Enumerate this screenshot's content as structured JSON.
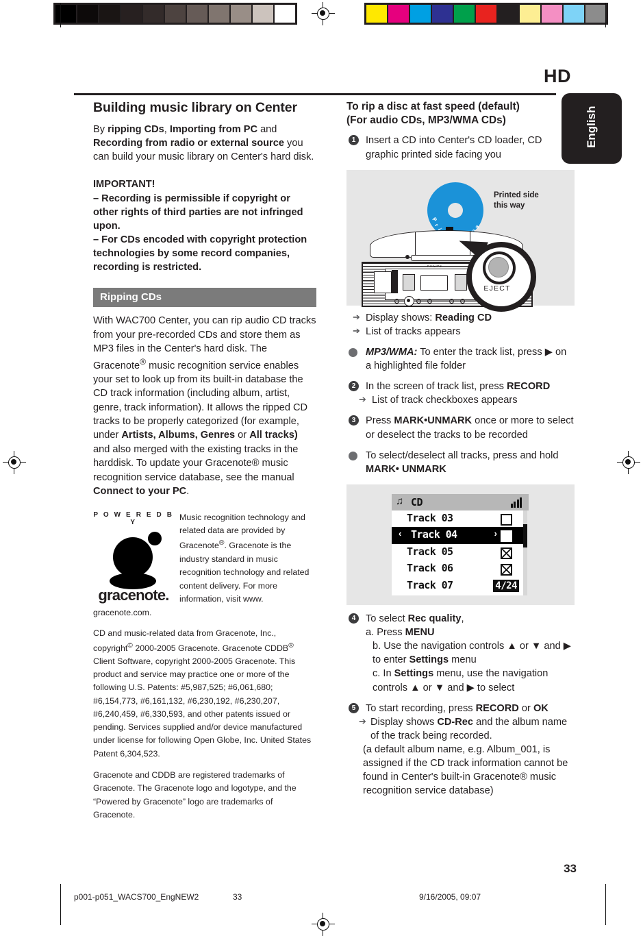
{
  "header": {
    "chapter": "HD",
    "language_tab": "English",
    "page_number": "33"
  },
  "left_column": {
    "title": "Building music library on Center",
    "intro": {
      "t1": "By ",
      "b1": "ripping CDs",
      "t2": ", ",
      "b2": "Importing from PC",
      "t3": " and ",
      "b3": "Recording from radio or external source",
      "t4": " you can build your music library on Center's hard disk."
    },
    "important": {
      "heading": "IMPORTANT!",
      "item1": "–   Recording is permissible if copyright or other rights of third parties are not infringed upon.",
      "item2": "–   For CDs encoded with copyright protection technologies by some record companies,  recording is restricted."
    },
    "band_heading": "Ripping CDs",
    "rip_body": {
      "p1": "With WAC700 Center, you can rip audio CD tracks from your pre-recorded CDs and store them as MP3 files in the Center's hard disk. The Gracenote",
      "sup1": "®",
      "p2": " music recognition service enables your set to look up from its built-in database the CD track information (including album, artist, genre, track information). It allows the ripped CD tracks to be properly categorized (for example, under ",
      "b1": "Artists,  Albums, Genres",
      "p3": " or ",
      "b2": "All tracks)",
      "p4": " and also merged with the existing tracks in the harddisk.  To update your Gracenote® music recognition service database, see the manual ",
      "b3": "Connect to your PC",
      "p5": "."
    },
    "gracenote": {
      "powered_by": "P O W E R E D   B Y",
      "wordmark": "gracenote.",
      "blurb_a": "Music recognition technology and related data are provided by Gracenote",
      "blurb_sup": "®",
      "blurb_b": ". Gracenote is the industry standard in music recognition technology and related content delivery.  For more information, visit www.",
      "blurb_c": "gracenote.com."
    },
    "legal": {
      "p1_a": "CD and music-related data from Gracenote, Inc., copyright",
      "p1_sup1": "©",
      "p1_b": " 2000-2005 Gracenote. Gracenote CDDB",
      "p1_sup2": "®",
      "p1_c": " Client Software, copyright 2000-2005 Gracenote. This product and service may practice one or more of the following U.S. Patents: #5,987,525; #6,061,680; #6,154,773, #6,161,132, #6,230,192, #6,230,207, #6,240,459, #6,330,593, and other patents issued or pending. Services supplied and/or device manufactured under license for following Open Globe, Inc. United States Patent 6,304,523.",
      "p2": "Gracenote and CDDB are registered trademarks of Gracenote. The Gracenote logo and logotype, and the “Powered by Gracenote” logo are trademarks of Gracenote."
    }
  },
  "right_column": {
    "title_line1": "To rip a disc at fast speed (default)",
    "title_line2": "(For audio CDs, MP3/WMA CDs)",
    "step1": {
      "num": "1",
      "text": "Insert a CD into Center's CD loader, CD graphic printed side facing you"
    },
    "figure_cd": {
      "disc_text": "Printed   Side",
      "label": "Printed side this way",
      "eject": "EJECT",
      "brand": "PHILIPS"
    },
    "after_step1": {
      "arrow1_a": "Display shows: ",
      "arrow1_b": "Reading CD",
      "arrow2": "List of tracks appears"
    },
    "bullet_mp3": {
      "label": "MP3/WMA:",
      "text_a": " To enter the track list, press ",
      "glyph": "▶",
      "text_b": " on a highlighted file folder"
    },
    "step2": {
      "num": "2",
      "text_a": "In the screen of track list, press ",
      "text_b": "RECORD",
      "arrow": "List of track checkboxes appears"
    },
    "step3": {
      "num": "3",
      "text_a": "Press ",
      "text_b": "MARK•UNMARK",
      "text_c": " once or more to select or deselect the tracks to be recorded"
    },
    "bullet_all": {
      "text_a": " To select/deselect all tracks, press and hold",
      "text_b": "MARK• UNMARK"
    },
    "figure_lcd": {
      "source": "CD",
      "note_icon": "♫",
      "rows": [
        {
          "label": "Track 03",
          "checkbox": "empty",
          "selected": false
        },
        {
          "label": "Track 04",
          "checkbox": "empty",
          "selected": true
        },
        {
          "label": "Track 05",
          "checkbox": "checked",
          "selected": false
        },
        {
          "label": "Track 06",
          "checkbox": "checked",
          "selected": false
        },
        {
          "label": "Track 07",
          "checkbox": "badge",
          "selected": false
        }
      ],
      "badge": "4/24",
      "left_arrow": "‹",
      "right_arrow": "›"
    },
    "step4": {
      "num": "4",
      "lead_a": "To select ",
      "lead_b": "Rec quality",
      "lead_c": ",",
      "a_a": "a. Press ",
      "a_b": "MENU",
      "b_a": "b. Use the navigation controls ",
      "b_up": "▲",
      "b_mid": "  or  ",
      "b_dn": "▼",
      "b_and": "  and ",
      "b_rt": "▶",
      "b_end": " to enter ",
      "b_bold": "Settings",
      "b_tail": " menu",
      "c_a": "c.  In ",
      "c_b": "Settings",
      "c_c": " menu,  use the navigation controls ",
      "c_tail": " to select"
    },
    "step5": {
      "num": "5",
      "lead_a": "To start recording, press ",
      "lead_b": "RECORD",
      "lead_c": " or ",
      "lead_d": "OK",
      "arrow_a": "Display shows ",
      "arrow_b": "CD-Rec",
      "arrow_c": " and the album name of the track being recorded.",
      "tail": "(a default album name, e.g. Album_001, is assigned if the CD track information cannot be found in Center's built-in Gracenote® music recognition service database)"
    }
  },
  "footer": {
    "filename": "p001-p051_WACS700_EngNEW2",
    "page": "33",
    "timestamp": "9/16/2005, 09:07"
  },
  "print_marks": {
    "gray_wedge": [
      "#000000",
      "#0d0a0a",
      "#1a1514",
      "#272020",
      "#332b2a",
      "#4d4340",
      "#665b57",
      "#80756f",
      "#998e87",
      "#ccc3bd",
      "#ffffff"
    ],
    "color_bar": [
      "#ffe800",
      "#e6007e",
      "#00a0e3",
      "#2e3192",
      "#00a04b",
      "#e8231f",
      "#231f20",
      "#fdee93",
      "#f48fc3",
      "#7ed3f7",
      "#8c8c8c"
    ],
    "accent_cd_blue": "#1b92d8",
    "band_gray": "#7b7b7b"
  }
}
